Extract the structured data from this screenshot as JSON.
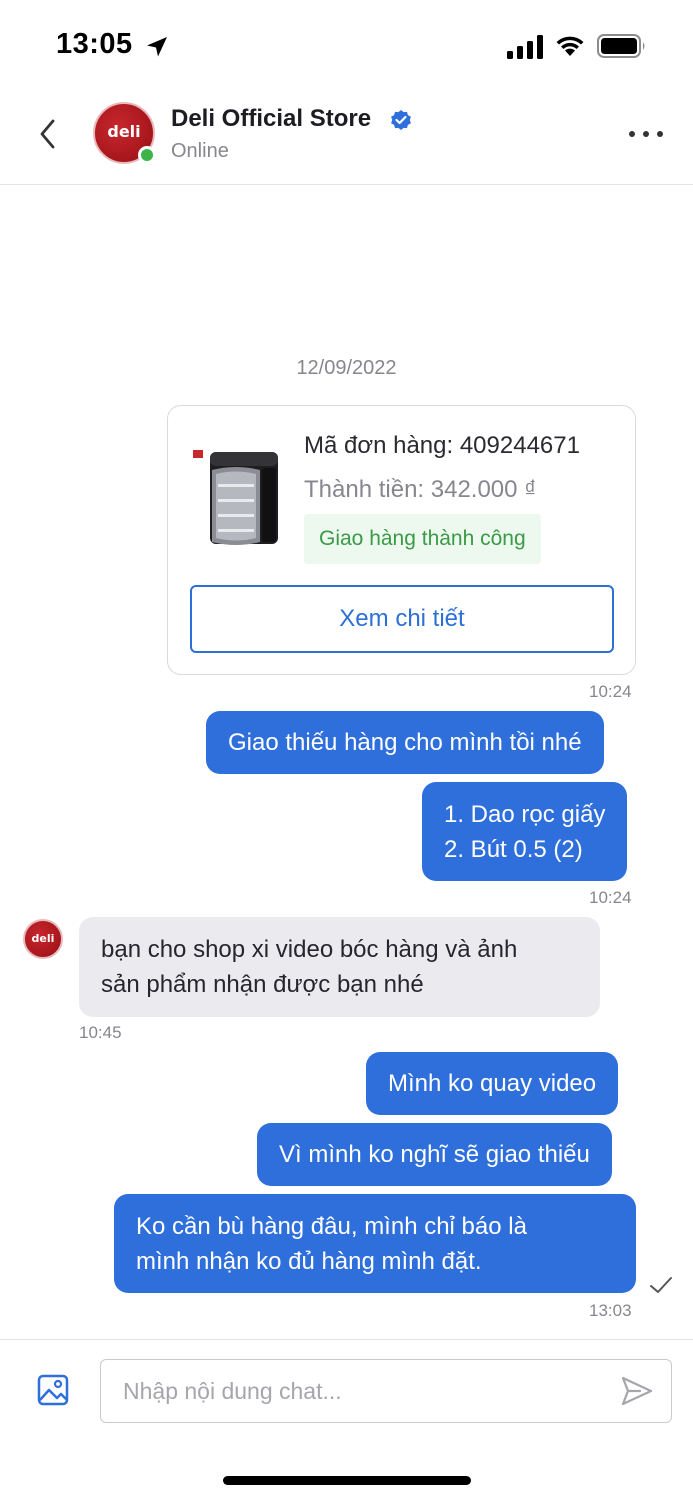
{
  "status_bar": {
    "time": "13:05",
    "icons": [
      "location-arrow-icon",
      "signal-icon",
      "wifi-icon",
      "battery-icon"
    ]
  },
  "header": {
    "store_name": "Deli Official Store",
    "status": "Online",
    "avatar_logo": "deli",
    "icons": [
      "back-icon",
      "verified-icon",
      "more-icon"
    ]
  },
  "chat": {
    "date": "12/09/2022",
    "order_card": {
      "order_id": "Mã đơn hàng: 409244671",
      "total": "Thành tiền: 342.000 ₫",
      "status": "Giao hàng thành công",
      "button": "Xem chi tiết",
      "time": "10:24"
    },
    "messages": [
      {
        "from": "me",
        "lines": [
          "Giao thiếu hàng cho mình tồi nhé"
        ]
      },
      {
        "from": "me",
        "lines": [
          "1. Dao rọc giấy",
          "2. Bút 0.5 (2)"
        ],
        "time": "10:24"
      },
      {
        "from": "shop",
        "lines": [
          "bạn cho shop xi video bóc hàng và ảnh",
          "sản phẩm nhận được bạn nhé"
        ],
        "time": "10:45"
      },
      {
        "from": "me",
        "lines": [
          "Mình ko quay video"
        ]
      },
      {
        "from": "me",
        "lines": [
          "Vì mình ko nghĩ sẽ giao thiếu"
        ]
      },
      {
        "from": "me",
        "lines": [
          "Ko cần bù hàng đâu, mình chỉ báo là",
          "mình nhận ko đủ hàng mình đặt."
        ],
        "time": "13:03"
      }
    ]
  },
  "input_bar": {
    "placeholder": "Nhập nội dung chat...",
    "icons": [
      "image-icon",
      "send-icon"
    ]
  },
  "colors": {
    "accent": "#2f6fdb",
    "incoming_bubble": "#ebebef",
    "success_text": "#3b9a47",
    "success_bg": "#edf8ef",
    "online": "#3bb54a",
    "brand": "#b71d24"
  }
}
